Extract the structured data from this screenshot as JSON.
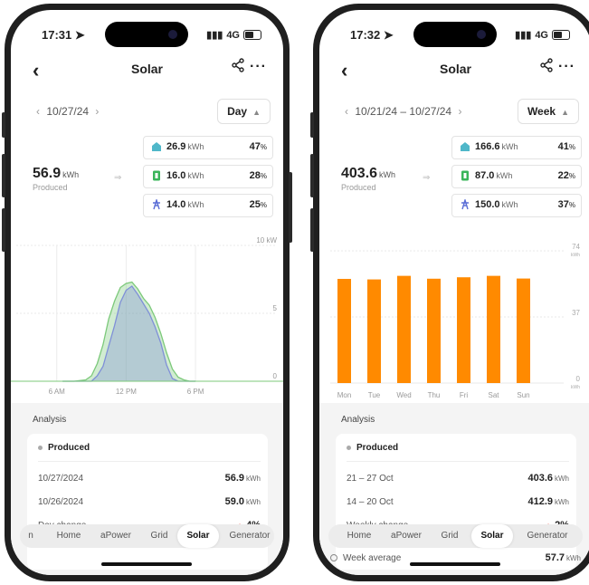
{
  "colors": {
    "accent_orange": "#ff8a00",
    "day_green": "#7cc97a",
    "day_blue": "#7f8fd8",
    "house_teal": "#4fb7c9",
    "battery_green": "#3ab55a",
    "grid_blue": "#5b6ed6",
    "decrease_red": "#e24b3b"
  },
  "left": {
    "status": {
      "time": "17:31",
      "signal": "4G"
    },
    "nav": {
      "title": "Solar"
    },
    "date": {
      "range": "10/27/24",
      "period": "Day"
    },
    "produced": {
      "value": "56.9",
      "unit": "kWh",
      "label": "Produced"
    },
    "breakdown": [
      {
        "icon": "house-icon",
        "value": "26.9",
        "unit": "kWh",
        "pct": "47",
        "pct_unit": "%"
      },
      {
        "icon": "battery-icon",
        "value": "16.0",
        "unit": "kWh",
        "pct": "28",
        "pct_unit": "%"
      },
      {
        "icon": "grid-tower-icon",
        "value": "14.0",
        "unit": "kWh",
        "pct": "25",
        "pct_unit": "%"
      }
    ],
    "analysis": {
      "title": "Analysis",
      "legend": "Produced",
      "rows": [
        {
          "label": "10/27/2024",
          "value": "56.9",
          "unit": "kWh"
        },
        {
          "label": "10/26/2024",
          "value": "59.0",
          "unit": "kWh"
        },
        {
          "label": "Day change",
          "value": "4%",
          "dir": "down"
        }
      ]
    },
    "tabs": [
      "n",
      "Home",
      "aPower",
      "Grid",
      "Solar",
      "Generator"
    ],
    "active_tab": "Solar"
  },
  "right": {
    "status": {
      "time": "17:32",
      "signal": "4G"
    },
    "nav": {
      "title": "Solar"
    },
    "date": {
      "range": "10/21/24 – 10/27/24",
      "period": "Week"
    },
    "produced": {
      "value": "403.6",
      "unit": "kWh",
      "label": "Produced"
    },
    "breakdown": [
      {
        "icon": "house-icon",
        "value": "166.6",
        "unit": "kWh",
        "pct": "41",
        "pct_unit": "%"
      },
      {
        "icon": "battery-icon",
        "value": "87.0",
        "unit": "kWh",
        "pct": "22",
        "pct_unit": "%"
      },
      {
        "icon": "grid-tower-icon",
        "value": "150.0",
        "unit": "kWh",
        "pct": "37",
        "pct_unit": "%"
      }
    ],
    "analysis": {
      "title": "Analysis",
      "legend": "Produced",
      "rows": [
        {
          "label": "21 – 27 Oct",
          "value": "403.6",
          "unit": "kWh"
        },
        {
          "label": "14 – 20 Oct",
          "value": "412.9",
          "unit": "kWh"
        },
        {
          "label": "Weekly change",
          "value": "2%",
          "dir": "down"
        }
      ],
      "week_avg": {
        "label": "Week average",
        "value": "57.7",
        "unit": "kWh"
      }
    },
    "tabs": [
      "Home",
      "aPower",
      "Grid",
      "Solar",
      "Generator"
    ],
    "active_tab": "Solar"
  },
  "chart_data": [
    {
      "type": "line",
      "title": "",
      "xlabel": "",
      "ylabel": "",
      "ylim": [
        0,
        10
      ],
      "yticks": [
        "10 kW",
        "5",
        "0"
      ],
      "xticks": [
        "6 AM",
        "12 PM",
        "6 PM"
      ],
      "x_hours": [
        6.5,
        7.5,
        8.5,
        9,
        9.5,
        10,
        10.5,
        11,
        11.5,
        12,
        12.5,
        13,
        13.5,
        14,
        14.5,
        15,
        15.5,
        16,
        16.5,
        17,
        17.5,
        18
      ],
      "series": [
        {
          "values": [
            0,
            0,
            0.1,
            0.4,
            1.3,
            2.7,
            4.6,
            5.9,
            6.9,
            7.2,
            7.3,
            6.8,
            6.1,
            5.6,
            4.7,
            3.5,
            2.1,
            0.9,
            0.3,
            0.1,
            0,
            0
          ]
        },
        {
          "values": [
            0,
            0,
            0,
            0,
            0.4,
            1.1,
            2.6,
            4.1,
            5.8,
            6.7,
            7.0,
            6.4,
            5.7,
            5.0,
            4.0,
            2.8,
            1.2,
            0.2,
            0,
            0,
            0,
            0
          ]
        }
      ]
    },
    {
      "type": "bar",
      "title": "",
      "xlabel": "",
      "ylabel": "",
      "ylim": [
        0,
        74
      ],
      "yticks": [
        "74",
        "37",
        "0"
      ],
      "y_unit": "kWh",
      "categories": [
        "Mon",
        "Tue",
        "Wed",
        "Thu",
        "Fri",
        "Sat",
        "Sun"
      ],
      "values": [
        58.3,
        58.0,
        60.0,
        58.4,
        59.2,
        60.0,
        58.5
      ]
    }
  ]
}
